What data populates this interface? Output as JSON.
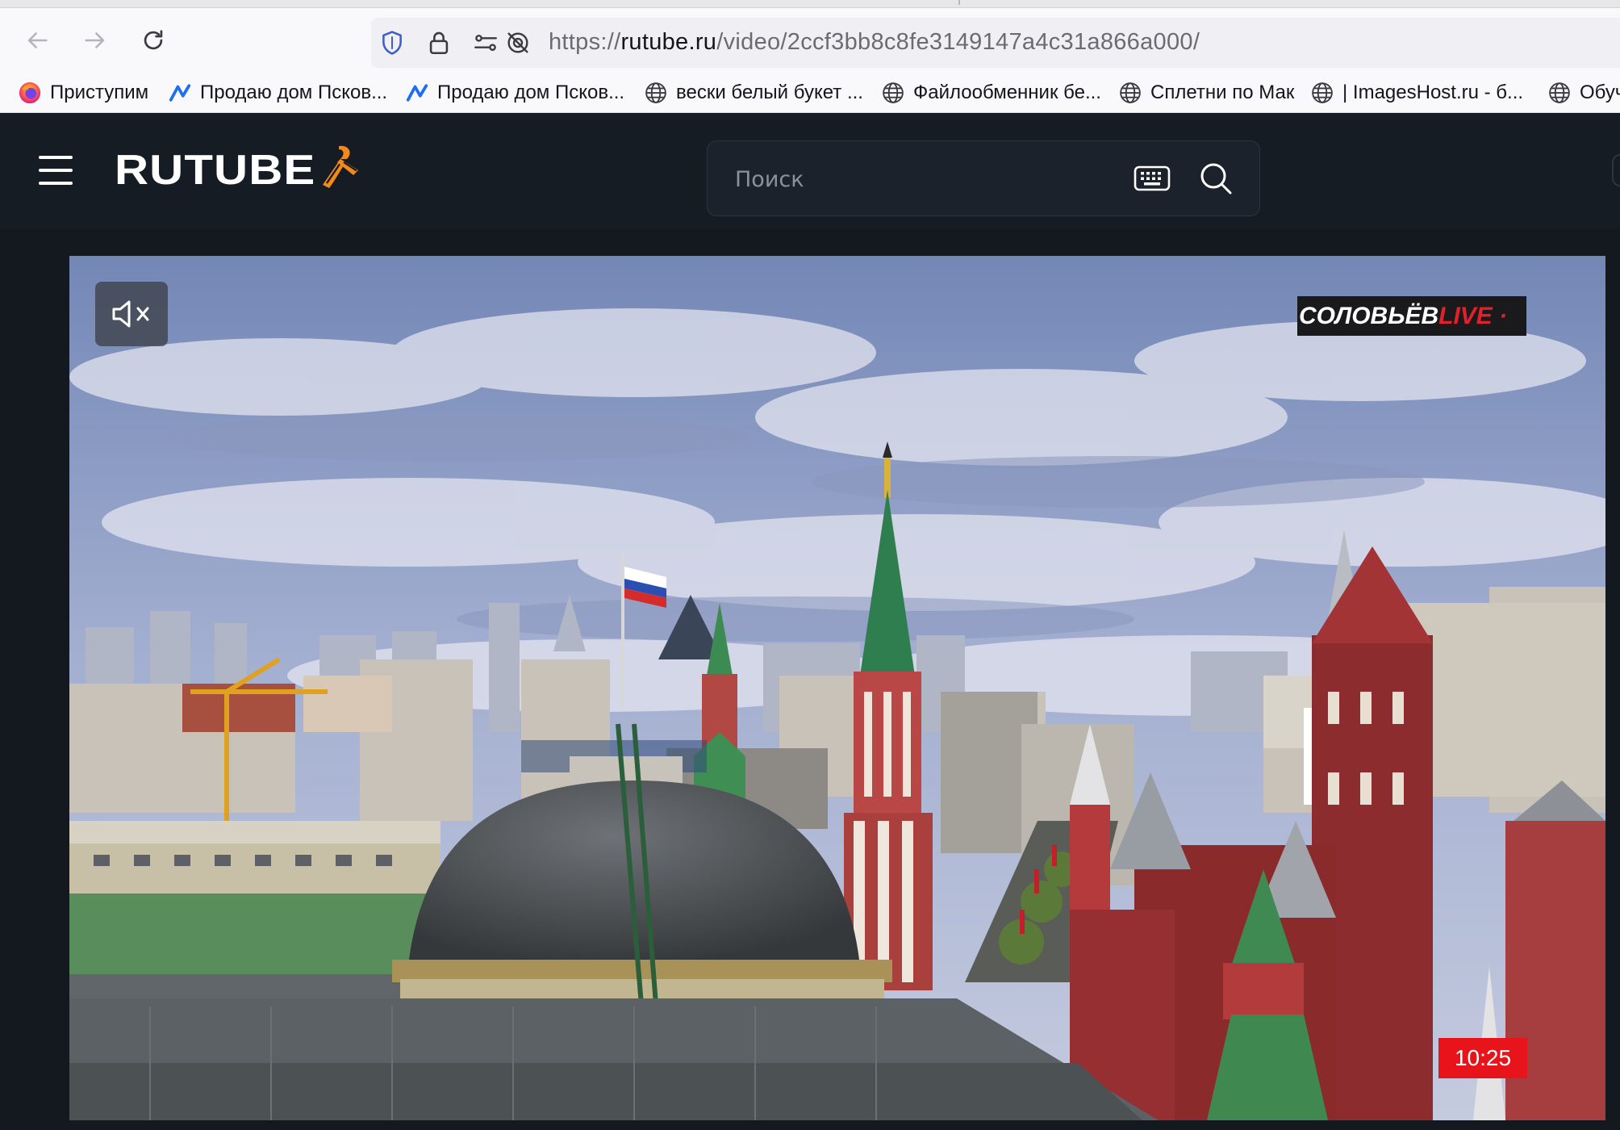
{
  "browser": {
    "url_prefix": "https://",
    "url_host": "rutube.ru",
    "url_path": "/video/2ccf3bb8c8fe3149147a4c31a866a000/",
    "bookmarks": [
      {
        "label": "Приступим",
        "icon": "firefox-icon"
      },
      {
        "label": "Продаю дом Псков...",
        "icon": "avito-icon"
      },
      {
        "label": "Продаю дом Псков...",
        "icon": "avito-icon"
      },
      {
        "label": "вески белый букет ...",
        "icon": "globe-icon"
      },
      {
        "label": "Файлообменник бе...",
        "icon": "globe-icon"
      },
      {
        "label": "Сплетни по Мак",
        "icon": "globe-icon"
      },
      {
        "label": "| ImagesHost.ru - б...",
        "icon": "globe-icon"
      },
      {
        "label": "Обуч",
        "icon": "globe-icon"
      }
    ]
  },
  "site": {
    "logo": "RUTUBE",
    "search_placeholder": "Поиск"
  },
  "player": {
    "channel_name": "СОЛОВЬЁВ",
    "channel_live": "LIVE · ",
    "time": "10:25"
  },
  "colors": {
    "header_bg": "#161c24",
    "page_bg": "#14191f",
    "live_badge": "#e8141c",
    "accent_orange": "#f08a1c"
  }
}
